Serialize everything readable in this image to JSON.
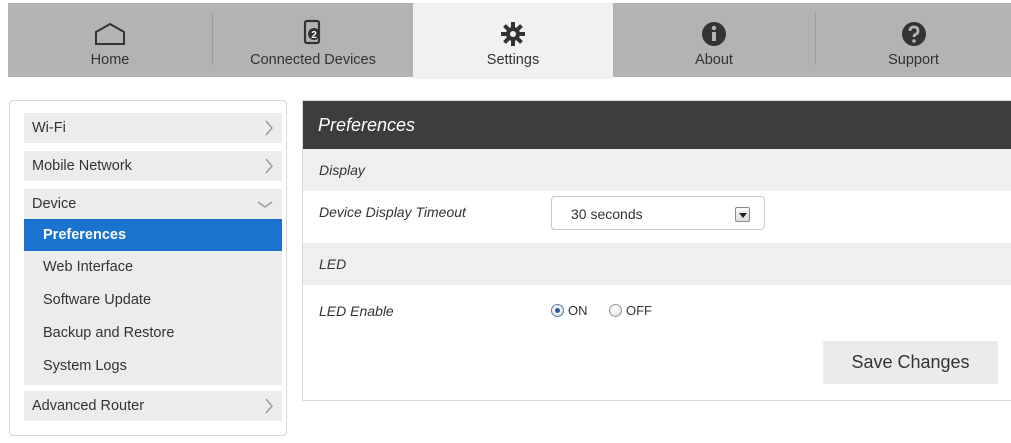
{
  "nav": {
    "tabs": [
      {
        "label": "Home",
        "icon": "home-icon"
      },
      {
        "label": "Connected Devices",
        "icon": "device-count-icon",
        "badge": "2"
      },
      {
        "label": "Settings",
        "icon": "gear-icon",
        "active": true
      },
      {
        "label": "About",
        "icon": "info-icon"
      },
      {
        "label": "Support",
        "icon": "question-icon"
      }
    ]
  },
  "sidebar": {
    "items": [
      {
        "label": "Wi-Fi"
      },
      {
        "label": "Mobile Network"
      },
      {
        "label": "Device",
        "expanded": true
      },
      {
        "label": "Advanced Router"
      }
    ],
    "device_subitems": [
      {
        "label": "Preferences",
        "active": true
      },
      {
        "label": "Web Interface"
      },
      {
        "label": "Software Update"
      },
      {
        "label": "Backup and Restore"
      },
      {
        "label": "System Logs"
      }
    ]
  },
  "main": {
    "title": "Preferences",
    "display_section": "Display",
    "display_timeout_label": "Device Display Timeout",
    "display_timeout_value": "30 seconds",
    "led_section": "LED",
    "led_enable_label": "LED Enable",
    "led_on_label": "ON",
    "led_off_label": "OFF",
    "led_selected": "ON",
    "save_label": "Save Changes"
  },
  "colors": {
    "nav_bg": "#b3b3b3",
    "active_tab_bg": "#f1f1f1",
    "panel_header_bg": "#3d3d3d",
    "active_item_bg": "#1a73cf"
  }
}
